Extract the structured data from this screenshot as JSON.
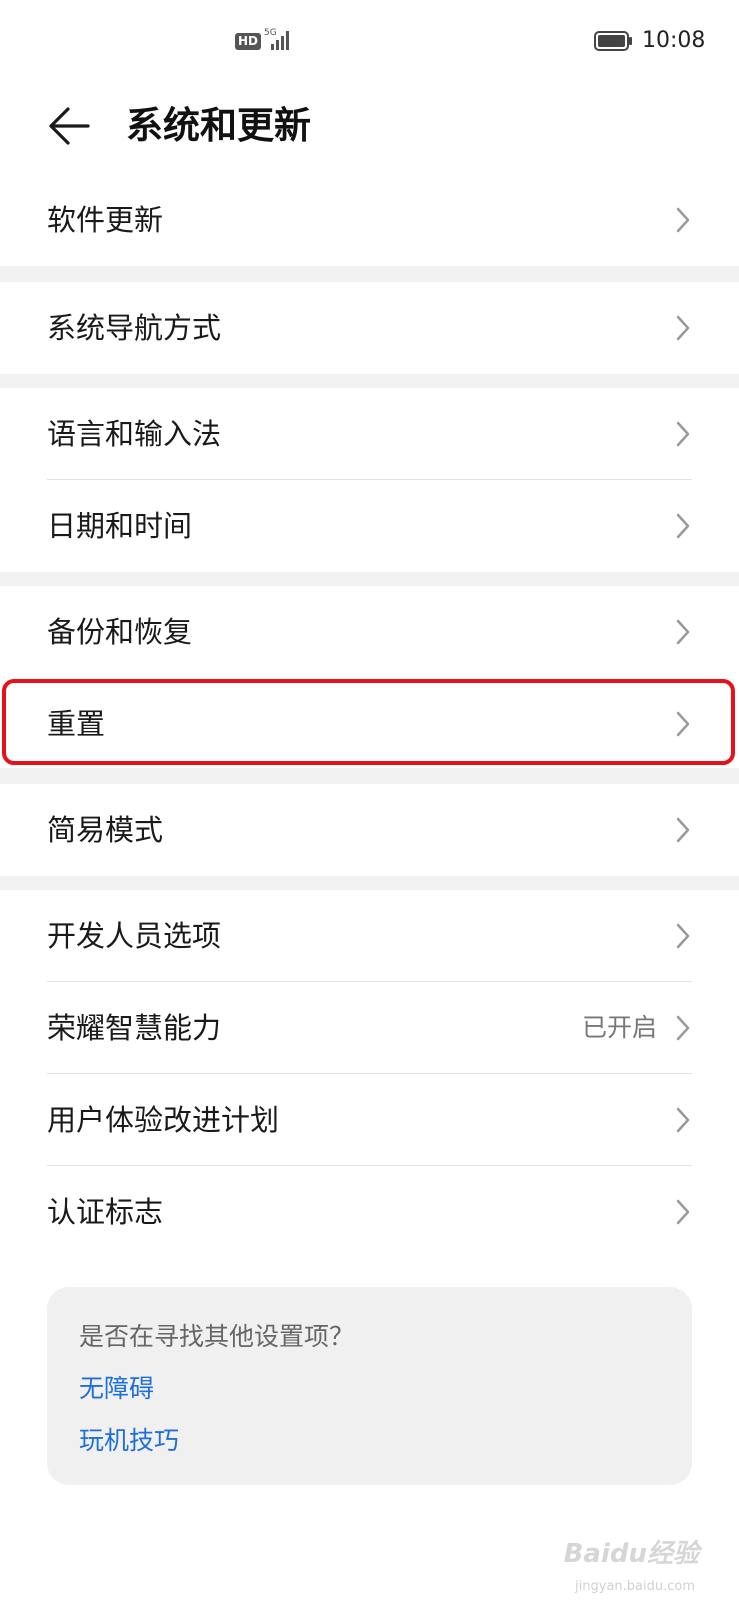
{
  "status_bar": {
    "hd_label": "HD",
    "network_label": "5G",
    "time": "10:08"
  },
  "header": {
    "title": "系统和更新"
  },
  "groups": [
    {
      "items": [
        {
          "label": "软件更新"
        }
      ]
    },
    {
      "items": [
        {
          "label": "系统导航方式"
        }
      ]
    },
    {
      "items": [
        {
          "label": "语言和输入法"
        },
        {
          "label": "日期和时间"
        }
      ]
    },
    {
      "items": [
        {
          "label": "备份和恢复"
        },
        {
          "label": "重置"
        }
      ]
    },
    {
      "items": [
        {
          "label": "简易模式"
        }
      ]
    },
    {
      "items": [
        {
          "label": "开发人员选项"
        },
        {
          "label": "荣耀智慧能力",
          "value": "已开启"
        },
        {
          "label": "用户体验改进计划"
        },
        {
          "label": "认证标志"
        }
      ]
    }
  ],
  "help_card": {
    "question": "是否在寻找其他设置项？",
    "links": [
      "无障碍",
      "玩机技巧"
    ]
  },
  "watermark": {
    "brand": "Baidu经验",
    "url": "jingyan.baidu.com"
  },
  "colors": {
    "highlight": "#e8101a",
    "link": "#1f6fd9",
    "group_gap": "#f2f2f2"
  }
}
